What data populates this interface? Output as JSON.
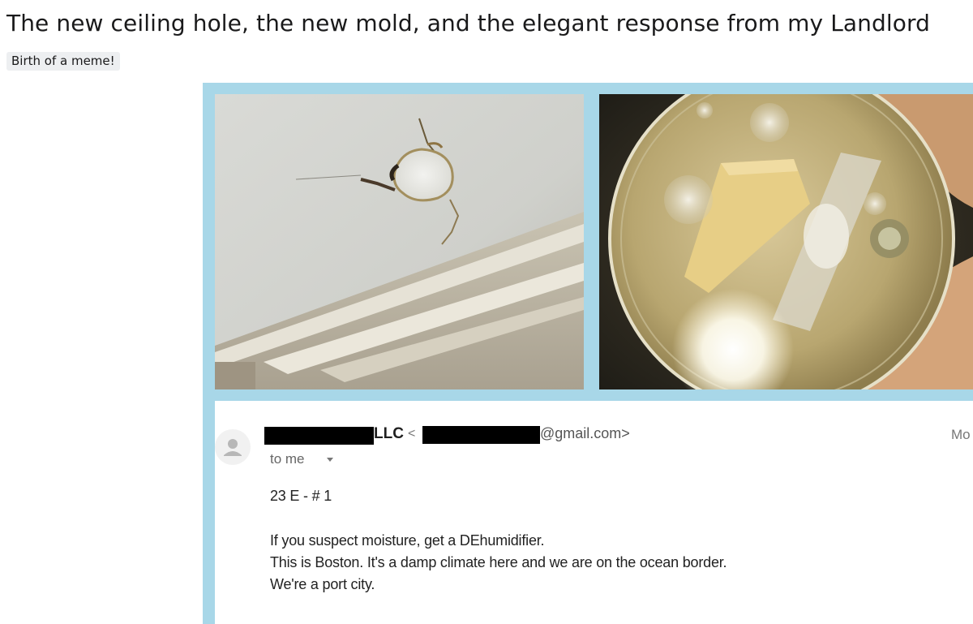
{
  "post": {
    "title": "The new ceiling hole, the new mold, and the elegant response from my Landlord",
    "flair": "Birth of a meme!"
  },
  "email": {
    "sender_company": "LLC",
    "sender_lt": "<",
    "sender_domain": "@gmail.com>",
    "more_label": "Mo",
    "recipient": "to me",
    "subject_line": "23 E - # 1",
    "body_lines": [
      "If you suspect moisture, get a DEhumidifier.",
      "This is Boston.  It's a damp climate here and we are on the ocean border.",
      "We're a port city."
    ]
  },
  "colors": {
    "image_border": "#a8d7e8",
    "flair_bg": "#edeff1",
    "redaction": "#000000"
  },
  "icons": {
    "avatar": "person-icon",
    "dropdown": "caret-down-icon"
  }
}
